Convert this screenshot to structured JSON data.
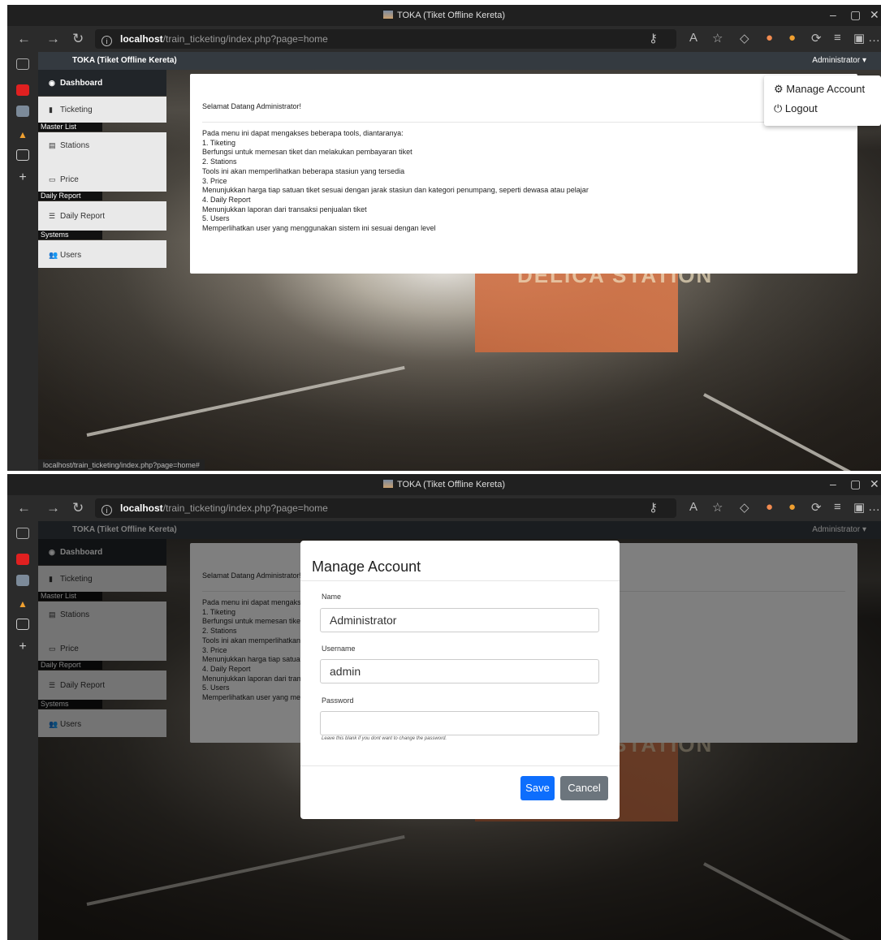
{
  "browser": {
    "window_title": "TOKA (Tiket Offline Kereta)",
    "url_info_icon": "info-icon",
    "url_host": "localhost",
    "url_path": "/train_ticketing/index.php?page=home",
    "status_url": "localhost/train_ticketing/index.php?page=home#"
  },
  "app": {
    "brand": "TOKA (Tiket Offline Kereta)",
    "user_label": "Administrator",
    "menu": {
      "dashboard": "Dashboard",
      "ticketing": "Ticketing",
      "master_list_header": "Master List",
      "stations": "Stations",
      "price": "Price",
      "daily_report_header": "Daily Report",
      "daily_report": "Daily Report",
      "systems_header": "Systems",
      "users": "Users"
    },
    "card": {
      "greeting": "Selamat Datang Administrator!",
      "lines": [
        "Pada menu ini dapat mengakses beberapa tools, diantaranya:",
        "1. Tiketing",
        "Berfungsi untuk memesan tiket dan melakukan pembayaran tiket",
        "2. Stations",
        "Tools ini akan memperlihatkan beberapa stasiun yang tersedia",
        "3. Price",
        "Menunjukkan harga tiap satuan tiket sesuai dengan jarak stasiun dan kategori penumpang, seperti dewasa atau pelajar",
        "4. Daily Report",
        "Menunjukkan laporan dari transaksi penjualan tiket",
        "5. Users",
        "Memperlihatkan user yang menggunakan sistem ini sesuai dengan level"
      ]
    },
    "dropdown": {
      "manage_account": "Manage Account",
      "logout": "Logout"
    },
    "modal": {
      "title": "Manage Account",
      "name_label": "Name",
      "name_value": "Administrator",
      "username_label": "Username",
      "username_value": "admin",
      "password_label": "Password",
      "password_value": "",
      "help": "Leave this blank if you dont want to change the password.",
      "save": "Save",
      "cancel": "Cancel"
    },
    "background_sign": "DELICA STATION"
  },
  "colors": {
    "navbar": "#343a40",
    "save_button": "#0d6efd",
    "cancel_button": "#6c757d"
  }
}
